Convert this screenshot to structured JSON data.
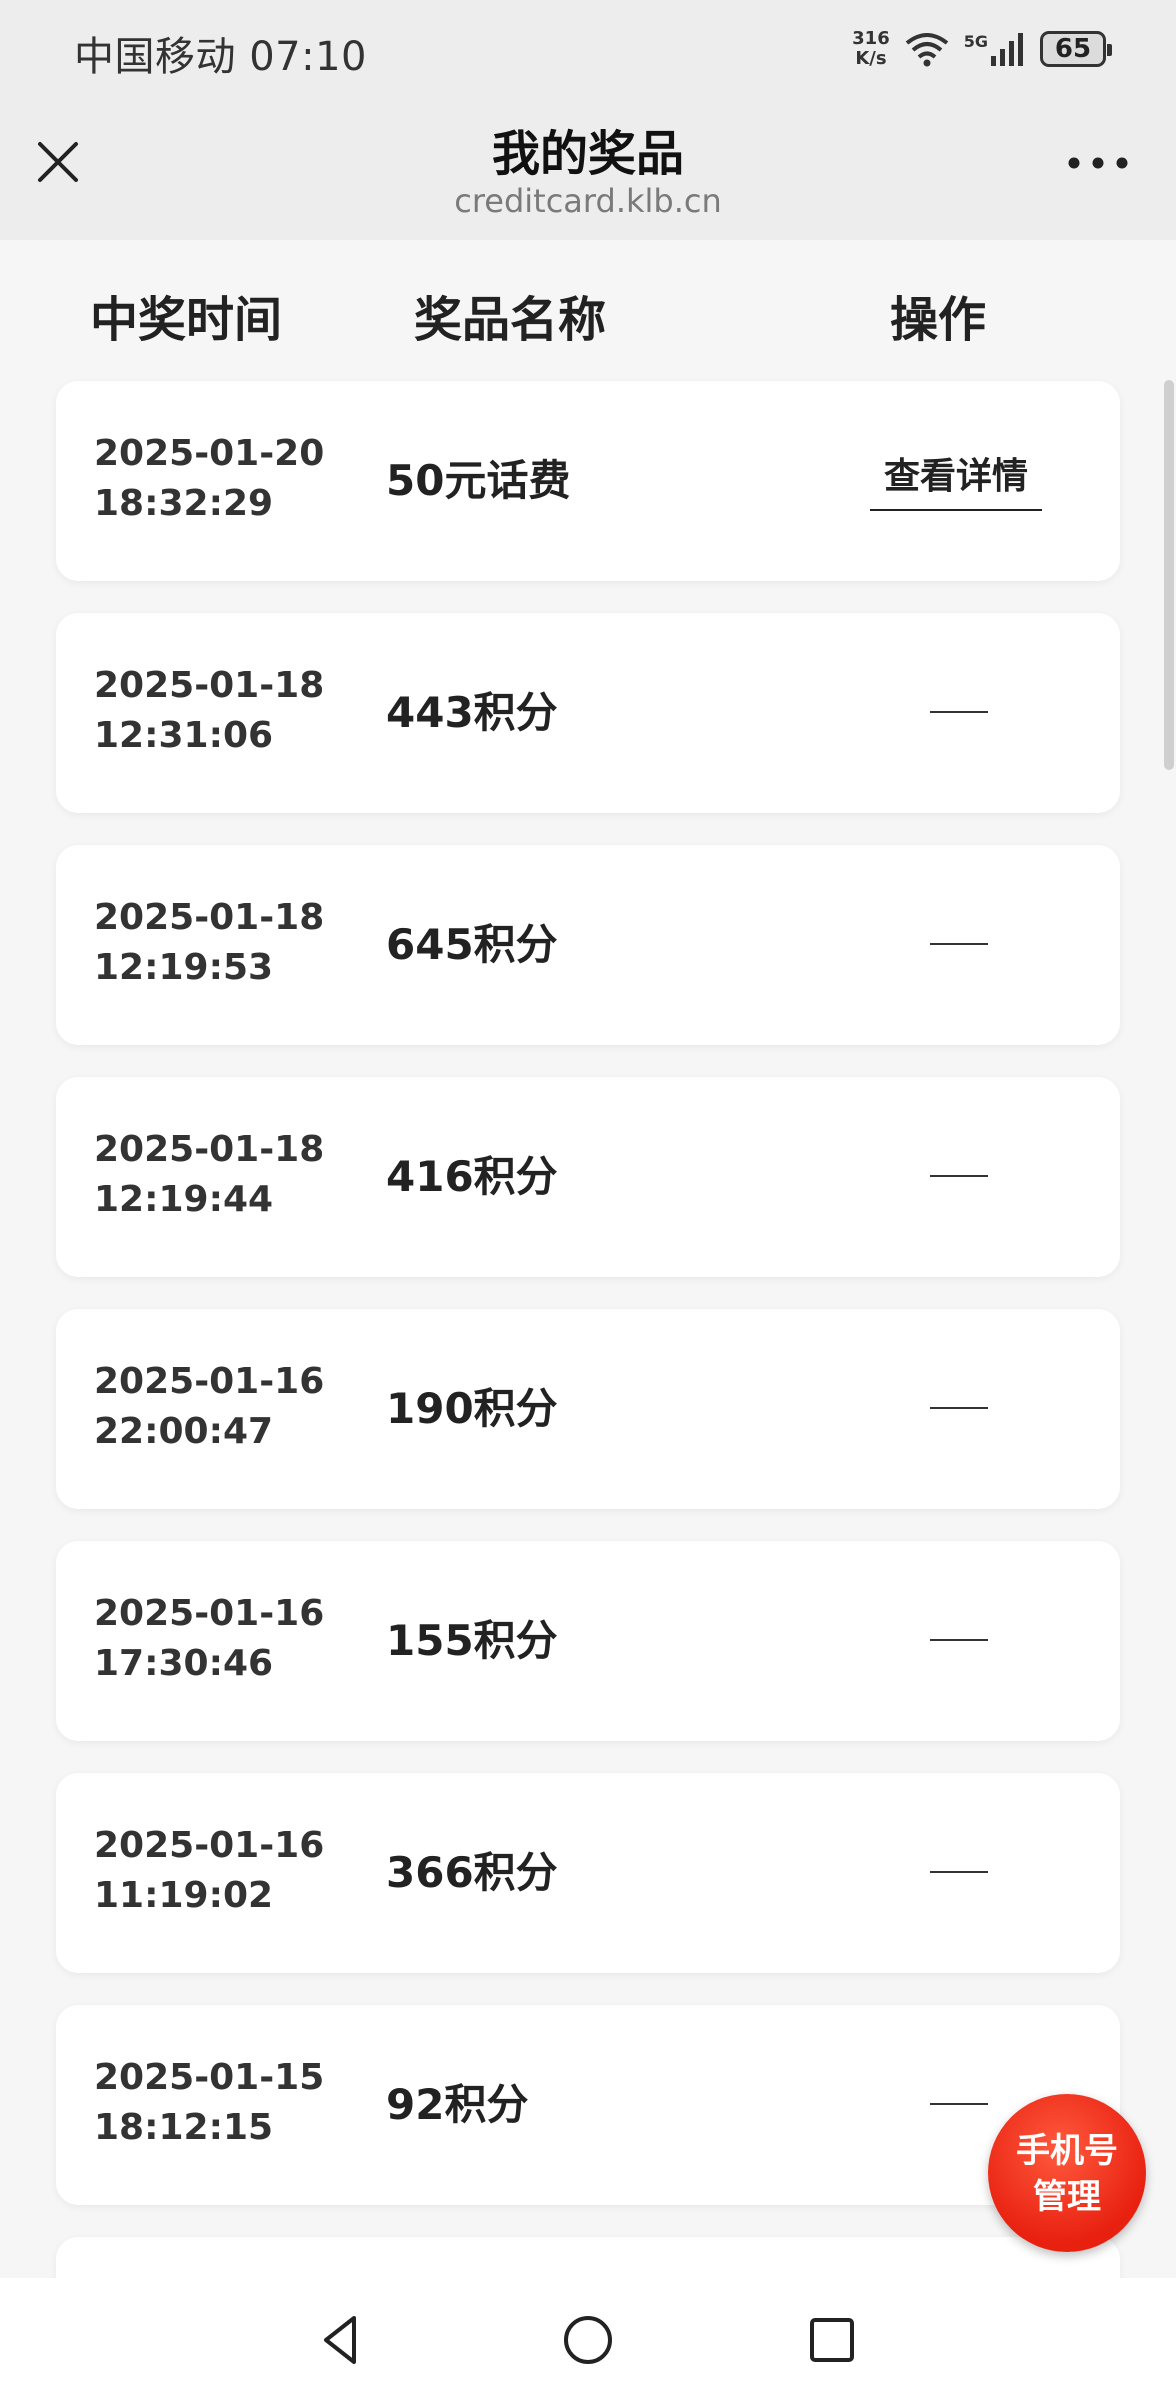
{
  "status_bar": {
    "carrier_time": "中国移动 07:10",
    "speed_top": "316",
    "speed_bottom": "K/s",
    "network": "5G",
    "battery": "65"
  },
  "header": {
    "title": "我的奖品",
    "url": "creditcard.klb.cn"
  },
  "columns": {
    "time": "中奖时间",
    "name": "奖品名称",
    "action": "操作"
  },
  "prizes": [
    {
      "date": "2025-01-20",
      "time": "18:32:29",
      "name": "50元话费",
      "action": "查看详情"
    },
    {
      "date": "2025-01-18",
      "time": "12:31:06",
      "name": "443积分"
    },
    {
      "date": "2025-01-18",
      "time": "12:19:53",
      "name": "645积分"
    },
    {
      "date": "2025-01-18",
      "time": "12:19:44",
      "name": "416积分"
    },
    {
      "date": "2025-01-16",
      "time": "22:00:47",
      "name": "190积分"
    },
    {
      "date": "2025-01-16",
      "time": "17:30:46",
      "name": "155积分"
    },
    {
      "date": "2025-01-16",
      "time": "11:19:02",
      "name": "366积分"
    },
    {
      "date": "2025-01-15",
      "time": "18:12:15",
      "name": "92积分"
    }
  ],
  "float_button": {
    "line1": "手机号",
    "line2": "管理"
  },
  "icons": {
    "close": "close-icon",
    "more": "more-icon",
    "wifi": "wifi-icon",
    "signal": "signal-icon",
    "back": "back-icon",
    "home": "home-icon",
    "recents": "recents-icon"
  }
}
